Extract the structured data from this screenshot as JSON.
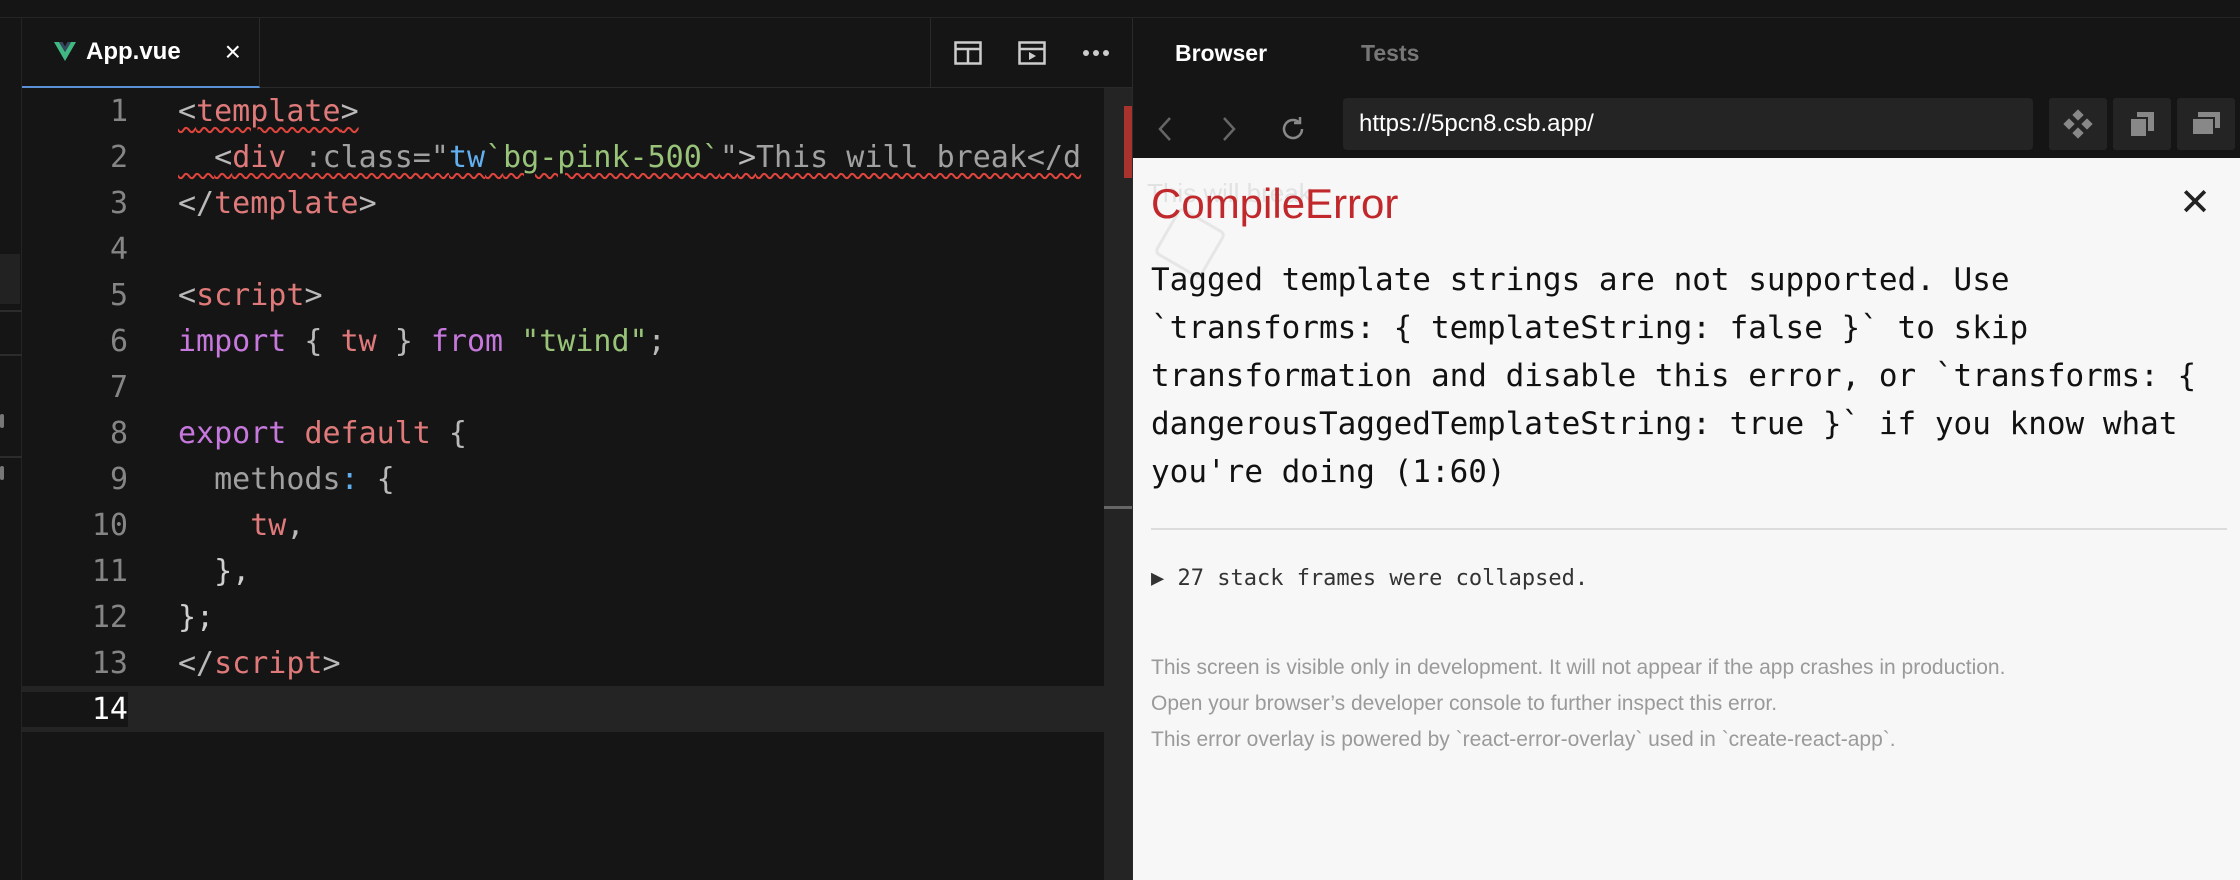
{
  "editor": {
    "tab_label": "App.vue",
    "close_glyph": "×",
    "lines": [
      {
        "n": "1"
      },
      {
        "n": "2"
      },
      {
        "n": "3"
      },
      {
        "n": "4"
      },
      {
        "n": "5"
      },
      {
        "n": "6"
      },
      {
        "n": "7"
      },
      {
        "n": "8"
      },
      {
        "n": "9"
      },
      {
        "n": "10"
      },
      {
        "n": "11"
      },
      {
        "n": "12"
      },
      {
        "n": "13"
      },
      {
        "n": "14"
      }
    ],
    "code": {
      "l1_open": "<",
      "l1_tag": "template",
      "l1_close": ">",
      "l2_indent": "  ",
      "l2_open": "<",
      "l2_tag": "div",
      "l2_attr": " :class=\"",
      "l2_tw": "tw",
      "l2_tick1": "`",
      "l2_val": "bg-pink-500",
      "l2_tick2": "`",
      "l2_q": "\"",
      "l2_gt": ">",
      "l2_text": "This will break</d",
      "l3_open": "</",
      "l3_tag": "template",
      "l3_close": ">",
      "l5_open": "<",
      "l5_tag": "script",
      "l5_close": ">",
      "l6_import": "import",
      "l6_b1": " { ",
      "l6_tw": "tw",
      "l6_b2": " } ",
      "l6_from": "from",
      "l6_sp": " ",
      "l6_str": "\"twind\"",
      "l6_semi": ";",
      "l8_export": "export",
      "l8_sp": " ",
      "l8_default": "default",
      "l8_brace": " {",
      "l9_indent": "  ",
      "l9_methods": "methods",
      "l9_colon": ":",
      "l9_brace": " {",
      "l10_indent": "    ",
      "l10_tw": "tw",
      "l10_comma": ",",
      "l11_text": "  },",
      "l12_text": "};",
      "l13_open": "</",
      "l13_tag": "script",
      "l13_close": ">"
    }
  },
  "panel": {
    "tabs": {
      "browser": "Browser",
      "tests": "Tests"
    },
    "url": "https://5pcn8.csb.app/",
    "ghost_text": "This will break",
    "error": {
      "title": "CompileError",
      "close_glyph": "✕",
      "message": "Tagged template strings are not supported. Use `transforms: { templateString: false }` to skip transformation and disable this error, or `transforms: { dangerousTaggedTemplateString: true }` if you know what you're doing (1:60)",
      "frames": "▶ 27 stack frames were collapsed.",
      "footer": [
        "This screen is visible only in development. It will not appear if the app crashes in production.",
        "Open your browser’s developer console to further inspect this error.",
        "This error overlay is powered by `react-error-overlay` used in `create-react-app`."
      ]
    }
  },
  "colors": {
    "accent": "#5a91d6",
    "error": "#c0282c",
    "vue_green": "#41b883"
  }
}
